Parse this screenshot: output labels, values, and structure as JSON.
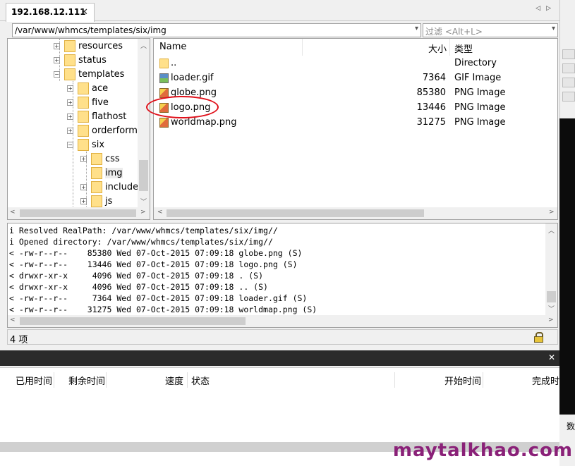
{
  "tab": {
    "title": "192.168.12.111",
    "close": "✕"
  },
  "path": {
    "value": "/var/www/whmcs/templates/six/img"
  },
  "filter": {
    "placeholder": "过滤 <Alt+L>"
  },
  "tree": {
    "items": [
      {
        "label": "resources",
        "expander": "+"
      },
      {
        "label": "status",
        "expander": "+"
      },
      {
        "label": "templates",
        "expander": "−"
      },
      {
        "label": "ace",
        "expander": "+"
      },
      {
        "label": "five",
        "expander": "+"
      },
      {
        "label": "flathost",
        "expander": "+"
      },
      {
        "label": "orderforms",
        "expander": "+"
      },
      {
        "label": "six",
        "expander": "−"
      },
      {
        "label": "css",
        "expander": "+"
      },
      {
        "label": "img",
        "expander": ""
      },
      {
        "label": "includes",
        "expander": "+"
      },
      {
        "label": "js",
        "expander": "+"
      }
    ]
  },
  "files": {
    "headers": {
      "name": "Name",
      "size": "大小",
      "type": "类型"
    },
    "rows": [
      {
        "name": "..",
        "size": "",
        "type": "Directory"
      },
      {
        "name": "loader.gif",
        "size": "7364",
        "type": "GIF Image"
      },
      {
        "name": "globe.png",
        "size": "85380",
        "type": "PNG Image"
      },
      {
        "name": "logo.png",
        "size": "13446",
        "type": "PNG Image"
      },
      {
        "name": "worldmap.png",
        "size": "31275",
        "type": "PNG Image"
      }
    ]
  },
  "log": {
    "lines": [
      "i Resolved RealPath: /var/www/whmcs/templates/six/img//",
      "i Opened directory: /var/www/whmcs/templates/six/img//",
      "< -rw-r--r--    85380 Wed 07-Oct-2015 07:09:18 globe.png (S)",
      "< -rw-r--r--    13446 Wed 07-Oct-2015 07:09:18 logo.png (S)",
      "< drwxr-xr-x     4096 Wed 07-Oct-2015 07:09:18 . (S)",
      "< drwxr-xr-x     4096 Wed 07-Oct-2015 07:09:18 .. (S)",
      "< -rw-r--r--     7364 Wed 07-Oct-2015 07:09:18 loader.gif (S)",
      "< -rw-r--r--    31275 Wed 07-Oct-2015 07:09:18 worldmap.png (S)"
    ]
  },
  "status": {
    "count": "4 项"
  },
  "transfer": {
    "close": "✕",
    "headers": {
      "elapsed": "已用时间",
      "remaining": "剩余时间",
      "speed": "速度",
      "state": "状态",
      "start": "开始时间",
      "finish": "完成时"
    }
  },
  "side": {
    "text": "数"
  },
  "watermark": {
    "text": "maytalkhao.com"
  }
}
